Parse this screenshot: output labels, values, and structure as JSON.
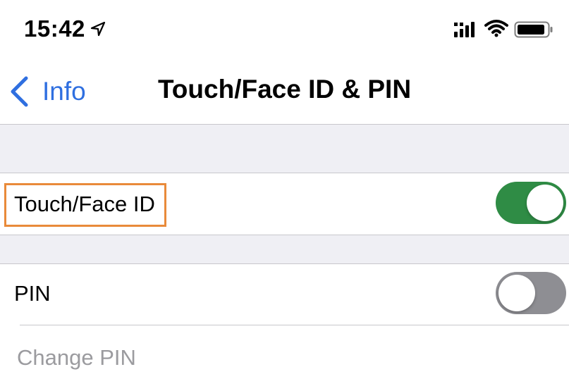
{
  "status_bar": {
    "time": "15:42",
    "icons": [
      "location-arrow-icon",
      "cellular-signal-icon",
      "wifi-icon",
      "battery-icon"
    ]
  },
  "nav": {
    "back_label": "Info",
    "title": "Touch/Face ID & PIN"
  },
  "settings": {
    "touch_face_id": {
      "label": "Touch/Face ID",
      "enabled": true
    },
    "pin": {
      "label": "PIN",
      "enabled": false
    },
    "change_pin": {
      "label": "Change PIN",
      "disabled": true
    }
  },
  "colors": {
    "accent_blue": "#2f6fe0",
    "toggle_on": "#2f8c45",
    "toggle_off": "#8e8e93",
    "highlight": "#e98a3a",
    "group_background": "#efeff4",
    "disabled_text": "#9b9b9f"
  }
}
